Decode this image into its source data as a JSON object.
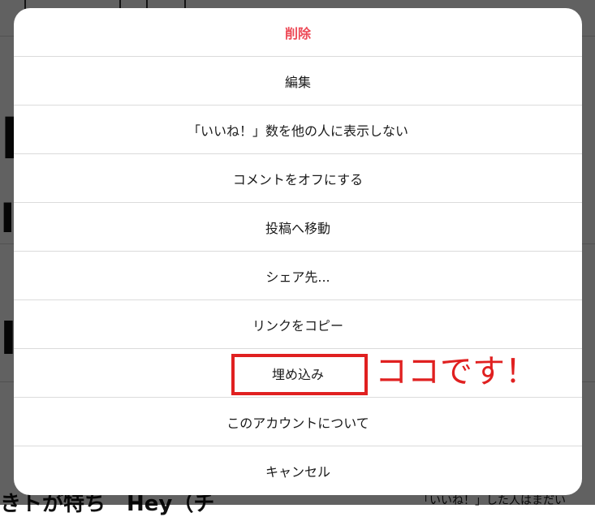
{
  "menu": {
    "items": [
      {
        "label": "削除",
        "variant": "danger"
      },
      {
        "label": "編集",
        "variant": "normal"
      },
      {
        "label": "「いいね！」数を他の人に表示しない",
        "variant": "normal"
      },
      {
        "label": "コメントをオフにする",
        "variant": "normal"
      },
      {
        "label": "投稿へ移動",
        "variant": "normal"
      },
      {
        "label": "シェア先...",
        "variant": "normal"
      },
      {
        "label": "リンクをコピー",
        "variant": "normal"
      },
      {
        "label": "埋め込み",
        "variant": "normal"
      },
      {
        "label": "このアカウントについて",
        "variant": "normal"
      },
      {
        "label": "キャンセル",
        "variant": "normal"
      }
    ]
  },
  "annotation": {
    "text": "ココです！",
    "color": "#e02020"
  },
  "background": {
    "bottom_text": "きトが特ち　Hey（チ",
    "right_text": "「いいね！」した人はまだい"
  },
  "colors": {
    "danger": "#ed4956",
    "divider": "#dbdbdb",
    "overlay": "rgba(0,0,0,0.62)"
  }
}
